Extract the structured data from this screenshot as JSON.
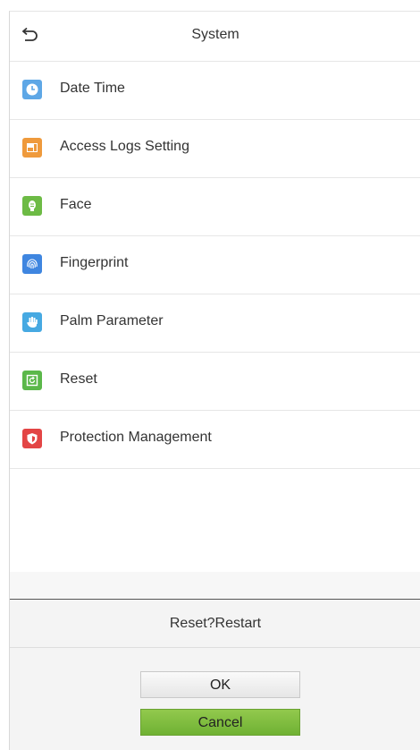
{
  "header": {
    "title": "System",
    "back_icon": "back-arrow-icon"
  },
  "menu": {
    "items": [
      {
        "label": "Date Time",
        "icon": "clock-icon",
        "color": "#5ea7e6"
      },
      {
        "label": "Access Logs Setting",
        "icon": "log-storage-icon",
        "color": "#ef9a3c"
      },
      {
        "label": "Face",
        "icon": "face-icon",
        "color": "#6dbb45"
      },
      {
        "label": "Fingerprint",
        "icon": "fingerprint-icon",
        "color": "#3f86e0"
      },
      {
        "label": "Palm Parameter",
        "icon": "palm-icon",
        "color": "#46a9e2"
      },
      {
        "label": "Reset",
        "icon": "reset-icon",
        "color": "#5bb84a"
      },
      {
        "label": "Protection Management",
        "icon": "shield-icon",
        "color": "#e34545"
      }
    ]
  },
  "dialog": {
    "message": "Reset?Restart",
    "ok_label": "OK",
    "cancel_label": "Cancel"
  }
}
